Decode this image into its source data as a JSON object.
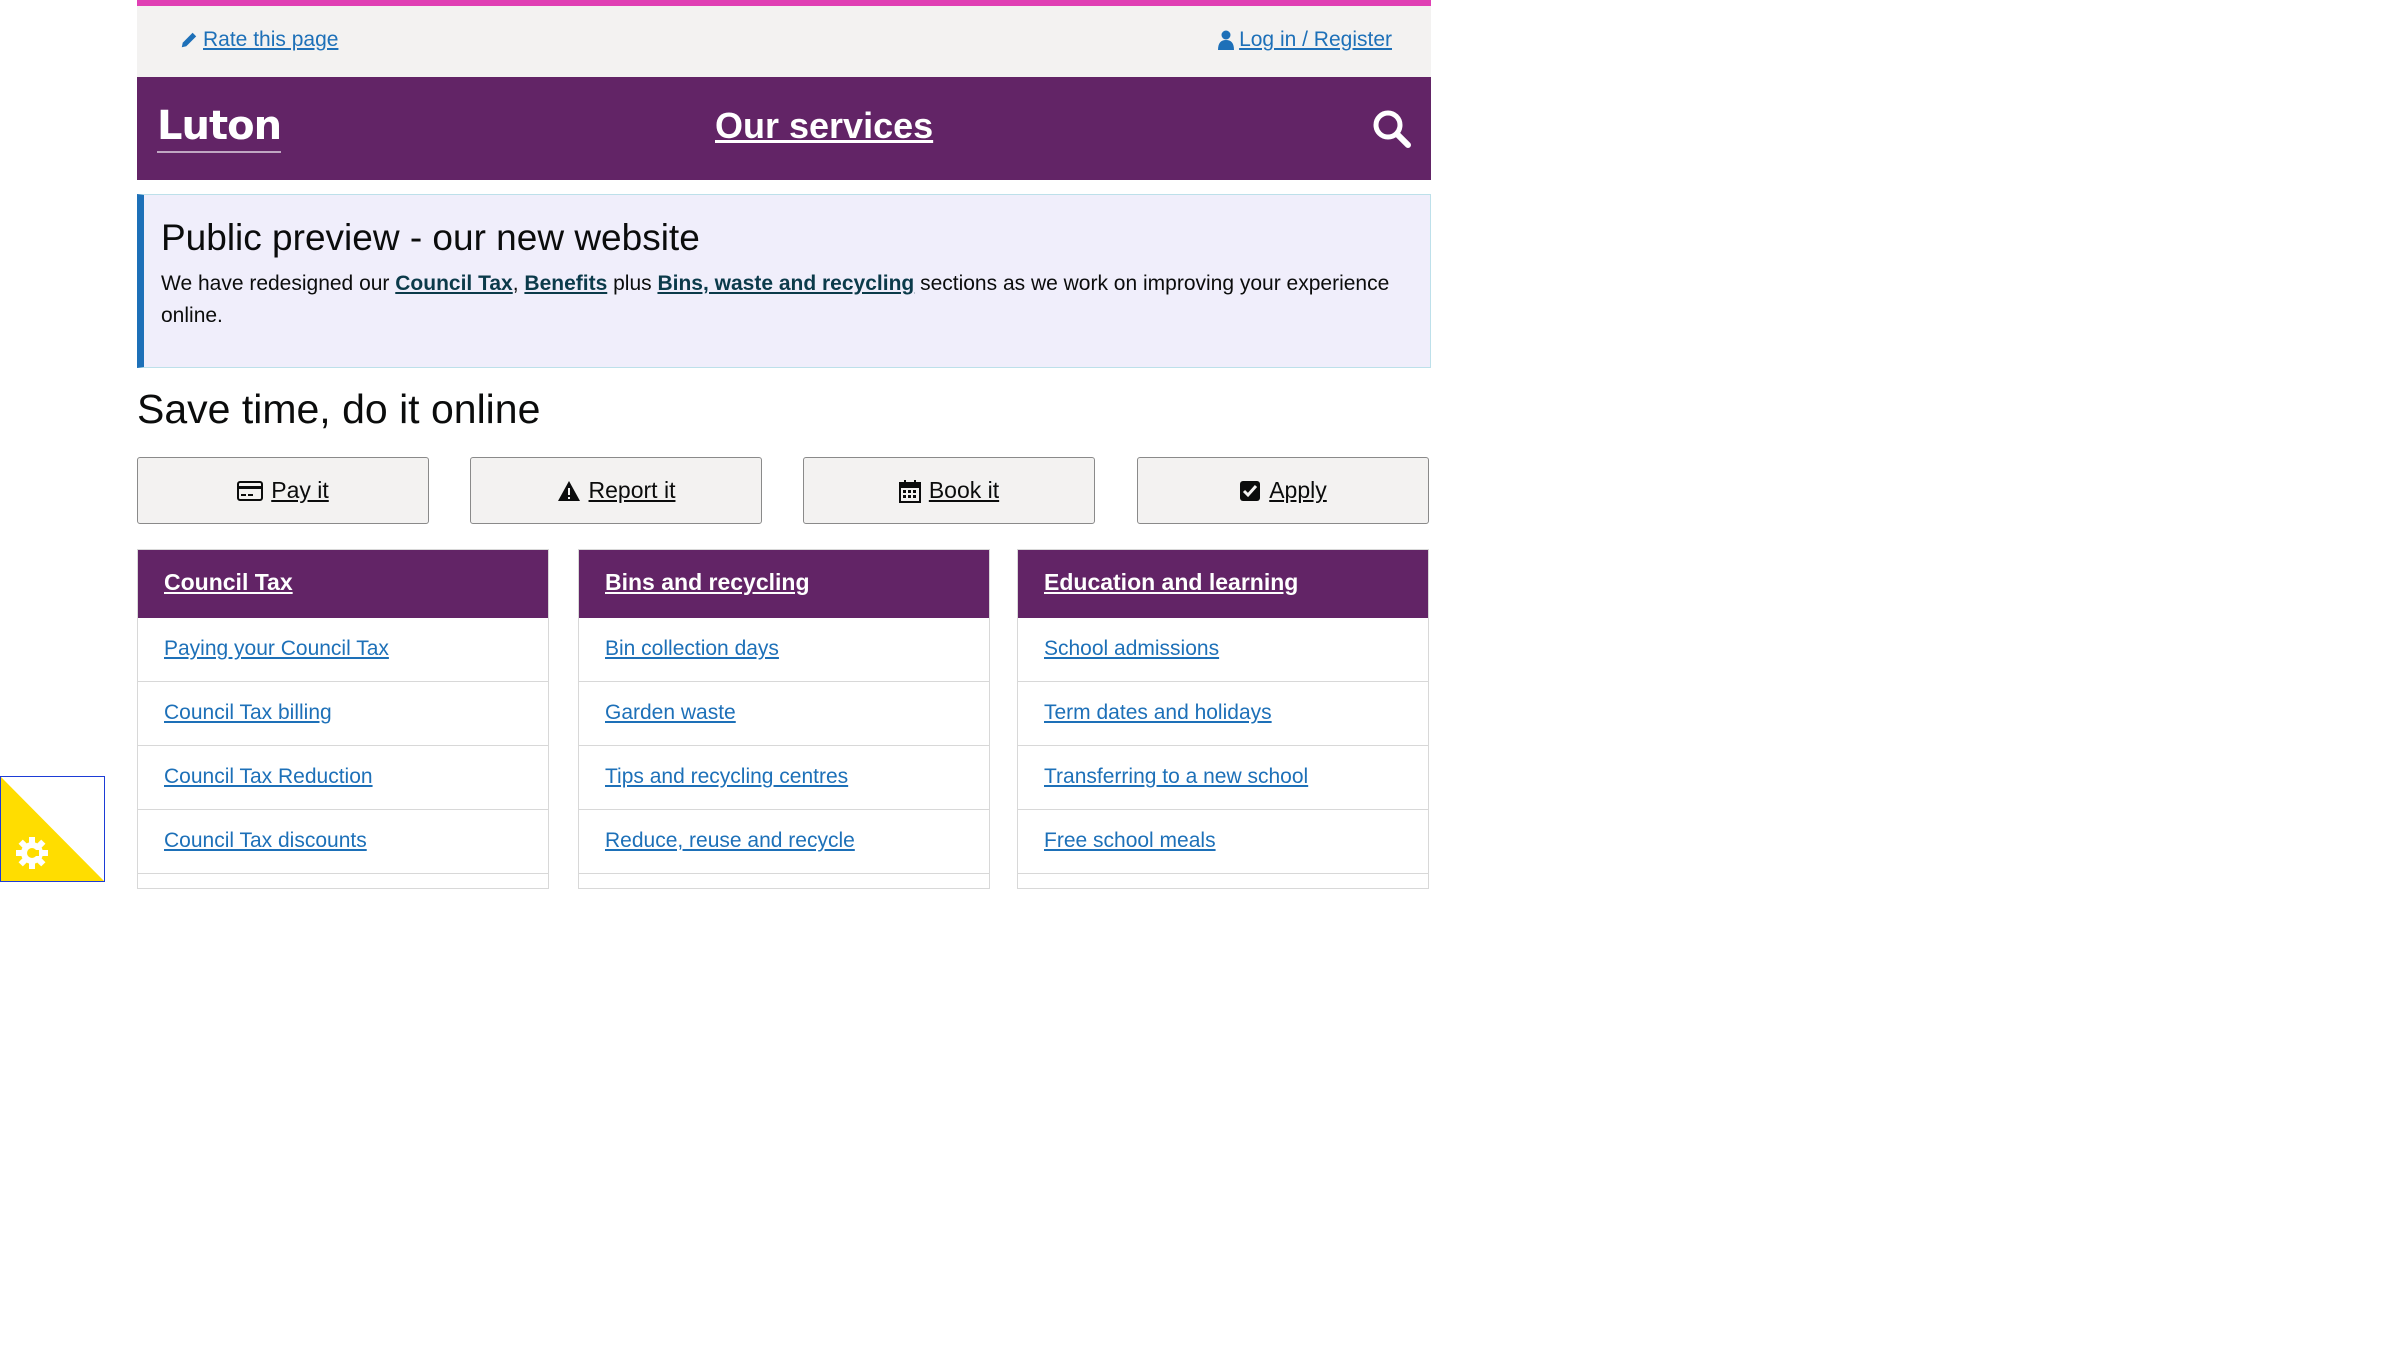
{
  "utility": {
    "rate_label": "Rate this page",
    "login_label": "Log in / Register"
  },
  "brand": {
    "logo": "Luton",
    "nav_label": "Our services"
  },
  "notice": {
    "title": "Public preview - our new website",
    "text_before": "We have redesigned our ",
    "link1": "Council Tax",
    "sep1": ", ",
    "link2": "Benefits",
    "sep2": " plus ",
    "link3": "Bins, waste and recycling",
    "text_after": " sections as we work on improving your experience online."
  },
  "section_title": "Save time, do it online",
  "quick_actions": [
    {
      "label": "Pay it",
      "icon": "credit-card-icon"
    },
    {
      "label": "Report it",
      "icon": "warning-icon"
    },
    {
      "label": "Book it",
      "icon": "calendar-icon"
    },
    {
      "label": "Apply",
      "icon": "checkbox-icon"
    }
  ],
  "cards": [
    {
      "title": "Council Tax",
      "items": [
        "Paying your Council Tax",
        "Council Tax billing",
        "Council Tax Reduction",
        "Council Tax discounts"
      ]
    },
    {
      "title": "Bins and recycling",
      "items": [
        "Bin collection days",
        "Garden waste",
        "Tips and recycling centres",
        "Reduce, reuse and recycle"
      ]
    },
    {
      "title": "Education and learning",
      "items": [
        "School admissions",
        "Term dates and holidays",
        "Transferring to a new school",
        "Free school meals"
      ]
    }
  ],
  "colors": {
    "brand_purple": "#622466",
    "accent_pink": "#e040b4",
    "link_blue": "#1d70b8",
    "cookie_yellow": "#ffdd00"
  }
}
